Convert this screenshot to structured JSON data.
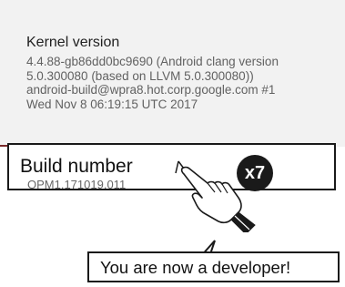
{
  "kernel": {
    "title": "Kernel version",
    "lines": [
      "4.4.88-gb86dd0bc9690 (Android clang version",
      "5.0.300080 (based on LLVM 5.0.300080))",
      "android-build@wpra8.hot.corp.google.com #1",
      "Wed Nov 8 06:19:15 UTC 2017"
    ]
  },
  "build": {
    "title": "Build number",
    "value": "OPM1.171019.011"
  },
  "tap_badge": "x7",
  "bubble": {
    "text": "You are now a developer!"
  },
  "icons": {
    "pointer": "tapping-hand-icon"
  }
}
